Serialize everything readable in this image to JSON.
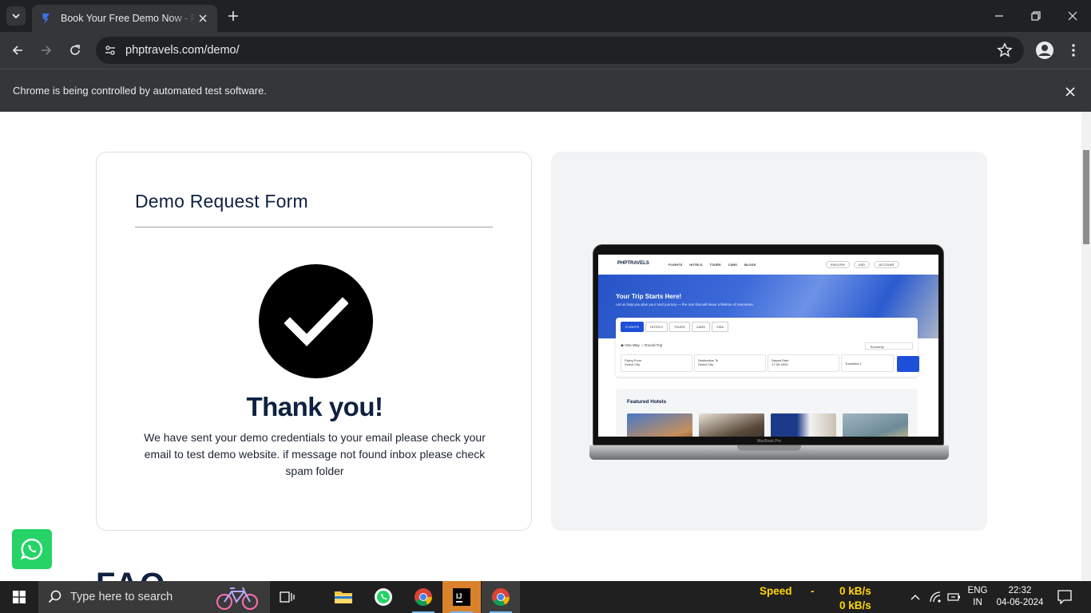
{
  "browser": {
    "tab_title": "Book Your Free Demo Now - PHPTRAVELS",
    "url": "phptravels.com/demo/",
    "infobar_text": "Chrome is being controlled by automated test software."
  },
  "form": {
    "title": "Demo Request Form",
    "thank_you": "Thank you!",
    "message": "We have sent your demo credentials to your email please check your email to test demo website. if message not found inbox please check spam folder"
  },
  "preview": {
    "logo": "PHPTRAVELS",
    "nav_links": "FLIGHTS HOTELS TOURS CARS BLOGS",
    "language": "ENGLISH",
    "currency": "USD",
    "account": "ACCOUNT",
    "hero_title": "Your Trip Starts Here!",
    "hero_subtitle": "Let us help you plan your next journey — the one that will leave a lifetime of memories.",
    "tabs": [
      "FLIGHTS",
      "HOTELS",
      "TOURS",
      "CARS",
      "VISA"
    ],
    "trip_types": [
      "One Way",
      "Round Trip"
    ],
    "cabin": "Economy",
    "flying_from_label": "Flying From",
    "flying_from_value": "Select City",
    "destination_label": "Destination To",
    "destination_value": "Select City",
    "depart_label": "Depart Date",
    "depart_value": "17-06-2024",
    "travellers": "Travellers 1",
    "featured": "Featured Hotels",
    "laptop_label": "MacBook Pro"
  },
  "faq_heading": "FAQ",
  "taskbar": {
    "search_placeholder": "Type here to search",
    "speed_label": "Speed",
    "speed_sep": "-",
    "speed_up": "0 kB/s",
    "speed_down": "0 kB/s",
    "lang_line1": "ENG",
    "lang_line2": "IN",
    "time": "22:32",
    "date": "04-06-2024"
  },
  "colors": {
    "heading": "#0f2040",
    "accent": "#1e4fd8",
    "whatsapp": "#25d366",
    "speed": "#ffd700"
  }
}
